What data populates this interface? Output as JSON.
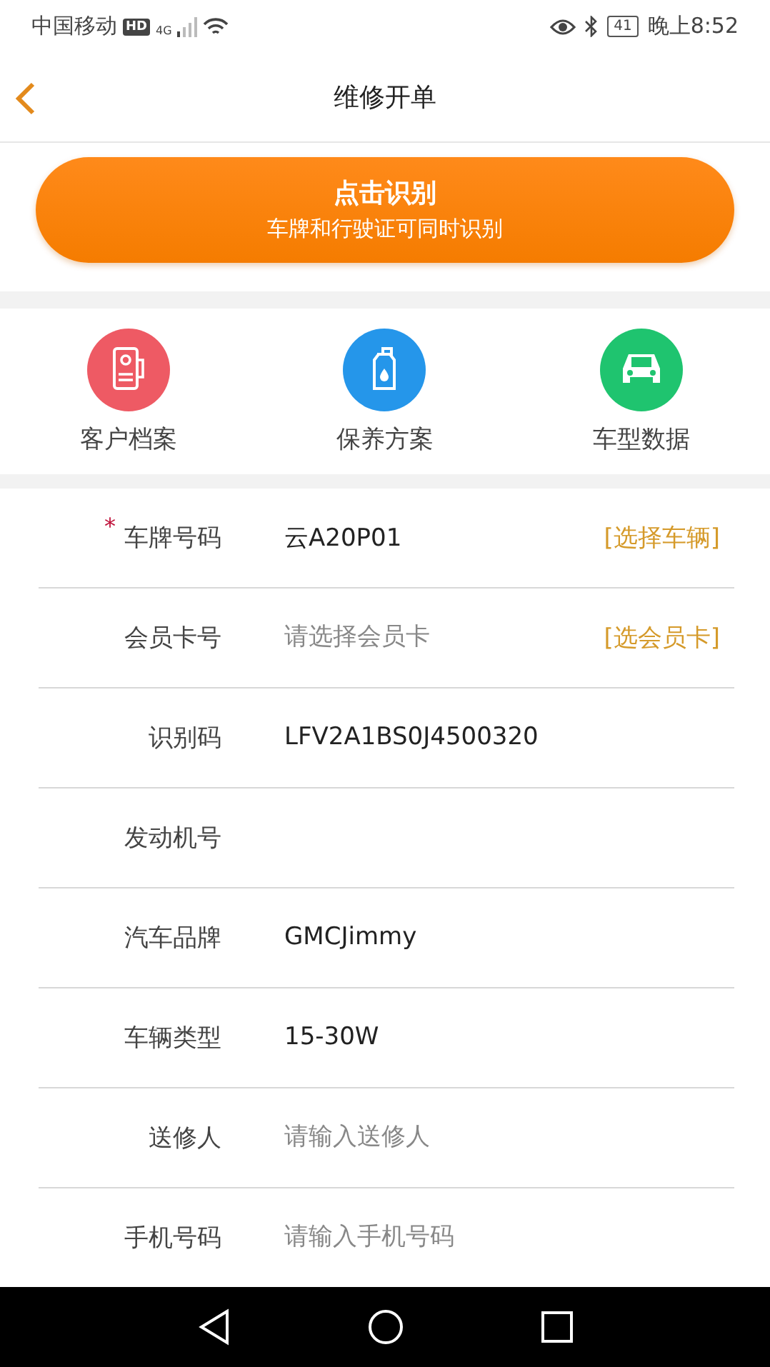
{
  "status_bar": {
    "carrier": "中国移动",
    "hd": "HD",
    "network": "4G",
    "battery": "41",
    "time": "晚上8:52"
  },
  "header": {
    "title": "维修开单"
  },
  "scan_button": {
    "title": "点击识别",
    "subtitle": "车牌和行驶证可同时识别"
  },
  "shortcuts": [
    {
      "label": "客户档案",
      "kind": "archive",
      "color": "#ee5a64"
    },
    {
      "label": "保养方案",
      "kind": "oil",
      "color": "#2596ea"
    },
    {
      "label": "车型数据",
      "kind": "car",
      "color": "#1fc46f"
    }
  ],
  "form": [
    {
      "label": "车牌号码",
      "required_mark": "*",
      "value": "云A20P01",
      "action": "[选择车辆]"
    },
    {
      "label": "会员卡号",
      "placeholder": "请选择会员卡",
      "action": "[选会员卡]"
    },
    {
      "label": "识别码",
      "value": "LFV2A1BS0J4500320"
    },
    {
      "label": "发动机号"
    },
    {
      "label": "汽车品牌",
      "value": "GMCJimmy"
    },
    {
      "label": "车辆类型",
      "value": "15-30W"
    },
    {
      "label": "送修人",
      "placeholder": "请输入送修人"
    },
    {
      "label": "手机号码",
      "placeholder": "请输入手机号码"
    }
  ]
}
